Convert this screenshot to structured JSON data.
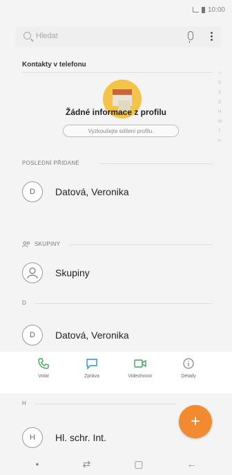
{
  "status_bar": {
    "time": "10:00"
  },
  "search": {
    "placeholder": "Hledat"
  },
  "section_title": "Kontakty v telefonu",
  "profile": {
    "title": "Žádné informace z profilu",
    "share_button": "Vyzkoušejte sdílení profilu."
  },
  "alphabet_index": [
    "☆",
    "D",
    "S",
    "D",
    "H",
    "M",
    "T",
    "#"
  ],
  "recent": {
    "header": "POSLEDNÍ PŘIDANÉ",
    "contact": {
      "initial": "D",
      "name": "Datová, Veronika"
    }
  },
  "groups": {
    "header": "SKUPINY",
    "item": {
      "name": "Skupiny"
    }
  },
  "section_d": {
    "header": "D",
    "contact": {
      "initial": "D",
      "name": "Datová, Veronika"
    }
  },
  "actions": [
    {
      "label": "Volat",
      "icon": "phone-icon",
      "color": "#3aa657"
    },
    {
      "label": "Zpráva",
      "icon": "message-icon",
      "color": "#2a8fd6"
    },
    {
      "label": "Videohovor",
      "icon": "video-icon",
      "color": "#3aa657"
    },
    {
      "label": "Detaily",
      "icon": "info-icon",
      "color": "#888888"
    }
  ],
  "section_h": {
    "header": "H",
    "contact": {
      "initial": "H",
      "name": "Hl. schr. Int."
    }
  },
  "fab": {
    "label": "+"
  },
  "colors": {
    "accent": "#f28a2f"
  }
}
